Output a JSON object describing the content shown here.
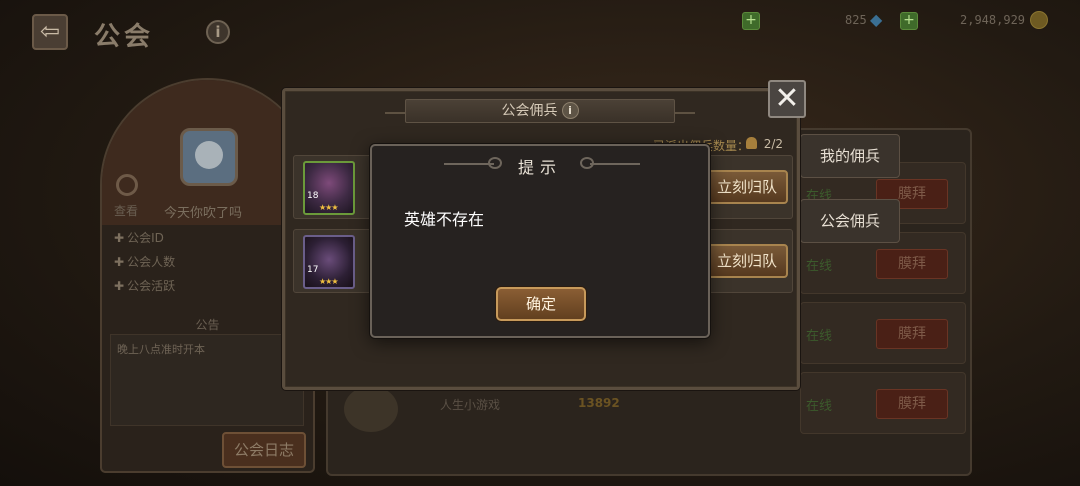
{
  "topbar": {
    "title": "公会",
    "gems": "825",
    "gold": "2,948,929"
  },
  "guild_panel": {
    "check_label": "查看",
    "guild_name": "今天你吹了吗",
    "stats": [
      "公会ID",
      "公会人数",
      "公会活跃"
    ],
    "notice_title": "公告",
    "notice_text": "晚上八点准时开本",
    "log_button": "公会日志"
  },
  "side_tabs": {
    "my_mercenaries": "我的佣兵",
    "guild_mercenaries": "公会佣兵"
  },
  "list_rows": {
    "status": [
      "在线",
      "在线",
      "在线",
      "在线"
    ],
    "worship_label": "膜拜",
    "dim_name": "人生小游戏",
    "dim_value": "13892"
  },
  "mercenary_window": {
    "title": "公会佣兵",
    "deploy_label": "已派出佣兵数量：",
    "deploy_value": "2/2",
    "rows": [
      {
        "level": "18",
        "stars": "★★★",
        "recall_label": "立刻归队"
      },
      {
        "level": "17",
        "stars": "★★★",
        "recall_label": "立刻归队"
      }
    ]
  },
  "dialog": {
    "title": "提示",
    "message": "英雄不存在",
    "ok_label": "确定"
  }
}
